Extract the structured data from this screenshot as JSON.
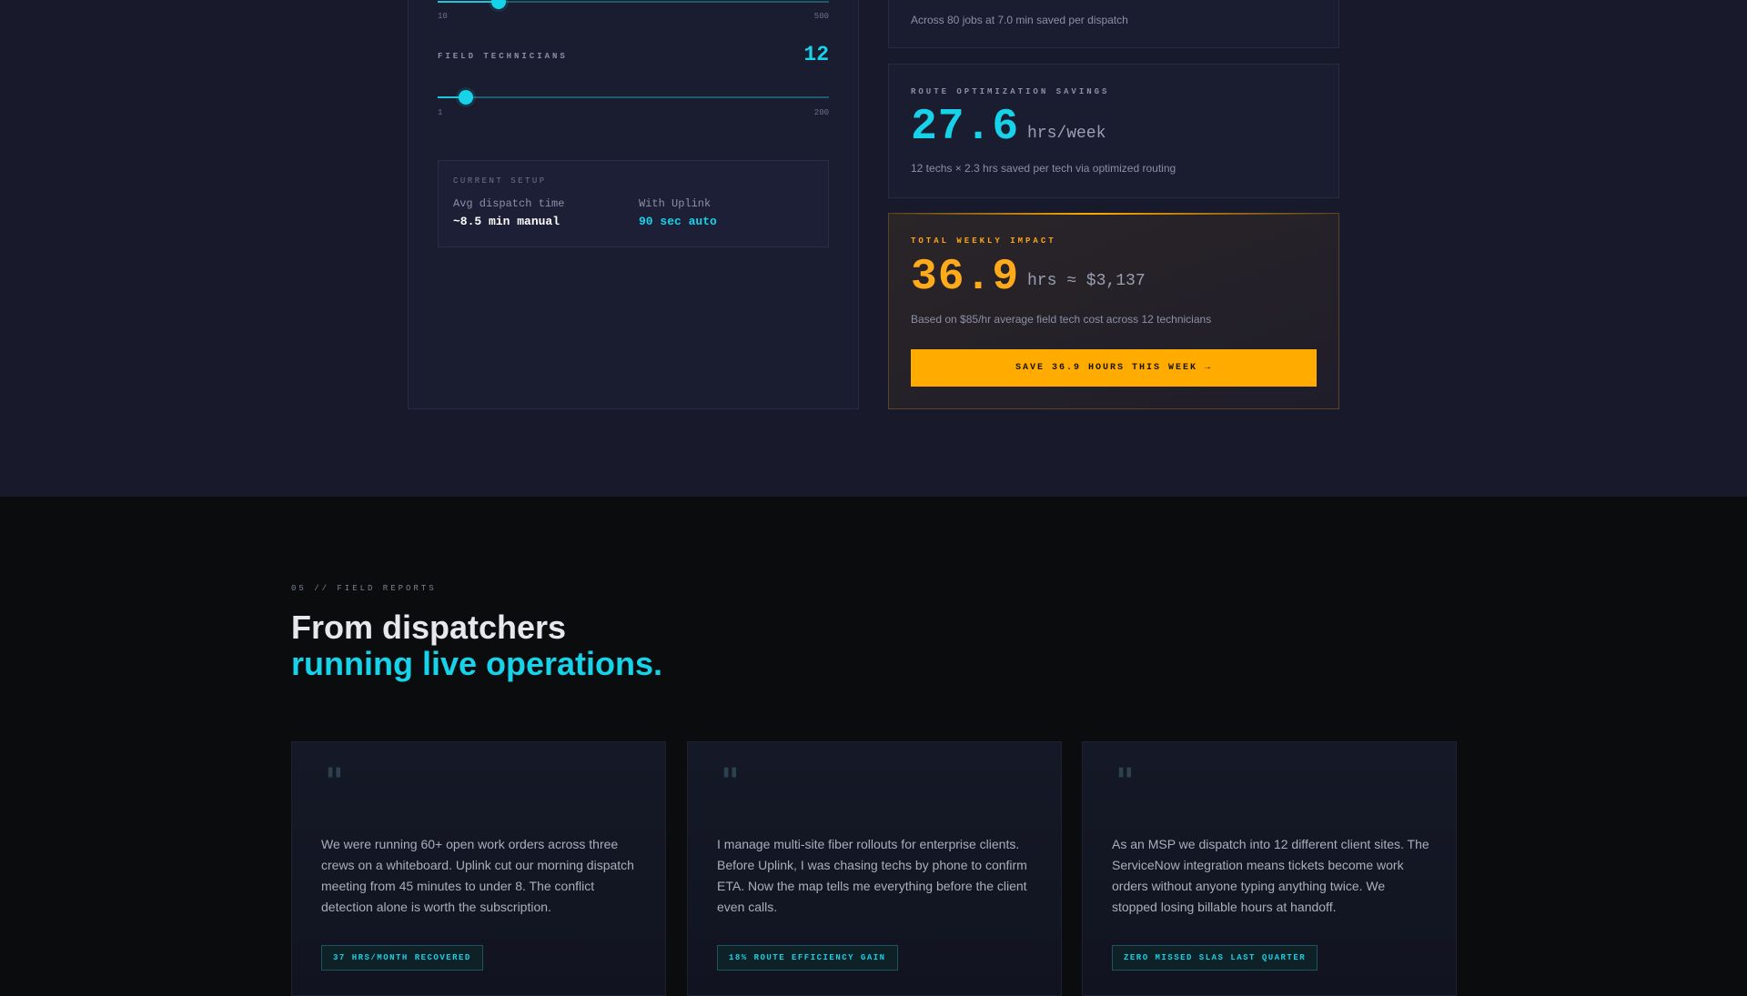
{
  "calculator": {
    "jobs_slider": {
      "min_label": "10",
      "max_label": "500",
      "fraction": 0.155
    },
    "technicians_slider": {
      "label": "FIELD TECHNICIANS",
      "value": "12",
      "min_label": "1",
      "max_label": "200",
      "fraction": 0.073
    },
    "current_setup": {
      "title": "CURRENT SETUP",
      "avg_label": "Avg dispatch time",
      "avg_value": "~8.5 min manual",
      "uplink_label": "With Uplink",
      "uplink_value": "90 sec auto"
    },
    "dispatch_card": {
      "note": "Across 80 jobs at 7.0 min saved per dispatch"
    },
    "route_card": {
      "label": "ROUTE OPTIMIZATION SAVINGS",
      "value": "27.6",
      "unit": "hrs/week",
      "note": "12 techs × 2.3 hrs saved per tech via optimized routing"
    },
    "impact_card": {
      "label": "TOTAL WEEKLY IMPACT",
      "value": "36.9",
      "unit": "hrs ≈ $3,137",
      "note": "Based on $85/hr average field tech cost across 12 technicians",
      "cta": "SAVE 36.9 HOURS THIS WEEK →"
    }
  },
  "reports": {
    "eyebrow": "05 // FIELD REPORTS",
    "headline_line1": "From dispatchers",
    "headline_line2": "running live operations.",
    "testimonials": [
      {
        "quote": "We were running 60+ open work orders across three crews on a whiteboard. Uplink cut our morning dispatch meeting from 45 minutes to under 8. The conflict detection alone is worth the subscription.",
        "badge": "37 HRS/MONTH RECOVERED"
      },
      {
        "quote": "I manage multi-site fiber rollouts for enterprise clients. Before Uplink, I was chasing techs by phone to confirm ETA. Now the map tells me everything before the client even calls.",
        "badge": "18% ROUTE EFFICIENCY GAIN"
      },
      {
        "quote": "As an MSP we dispatch into 12 different client sites. The ServiceNow integration means tickets become work orders without anyone typing anything twice. We stopped losing billable hours at handoff.",
        "badge": "ZERO MISSED SLAS LAST QUARTER"
      }
    ],
    "quote_glyph": "\""
  },
  "colors": {
    "accent": "#17d3ea",
    "impact": "#ffab00",
    "bg_top": "#181a2c",
    "bg_bottom": "#0b0c0e"
  }
}
